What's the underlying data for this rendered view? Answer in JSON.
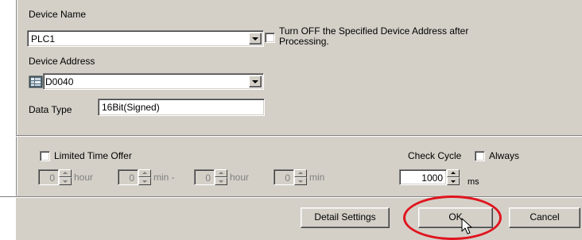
{
  "device": {
    "name_label": "Device Name",
    "name_value": "PLC1",
    "turn_off_label": "Turn OFF the Specified Device Address after Processing.",
    "turn_off_checked": false,
    "address_label": "Device Address",
    "address_value": "D0040",
    "data_type_label": "Data Type",
    "data_type_value": "16Bit(Signed)"
  },
  "time_offer": {
    "label": "Limited Time Offer",
    "checked": false,
    "fields": [
      {
        "value": "0",
        "unit": "hour"
      },
      {
        "value": "0",
        "unit": "min -"
      },
      {
        "value": "0",
        "unit": "hour"
      },
      {
        "value": "0",
        "unit": "min"
      }
    ]
  },
  "check_cycle": {
    "label": "Check Cycle",
    "always_label": "Always",
    "always_checked": false,
    "value": "1000",
    "unit": "ms"
  },
  "buttons": {
    "detail_settings": "Detail Settings",
    "ok": "OK",
    "cancel": "Cancel"
  },
  "colors": {
    "panel": "#d4d0c8",
    "highlight_ring": "#e0141e"
  },
  "icons": {
    "address_icon": "device-grid-icon",
    "cursor": "mouse-pointer-icon"
  }
}
